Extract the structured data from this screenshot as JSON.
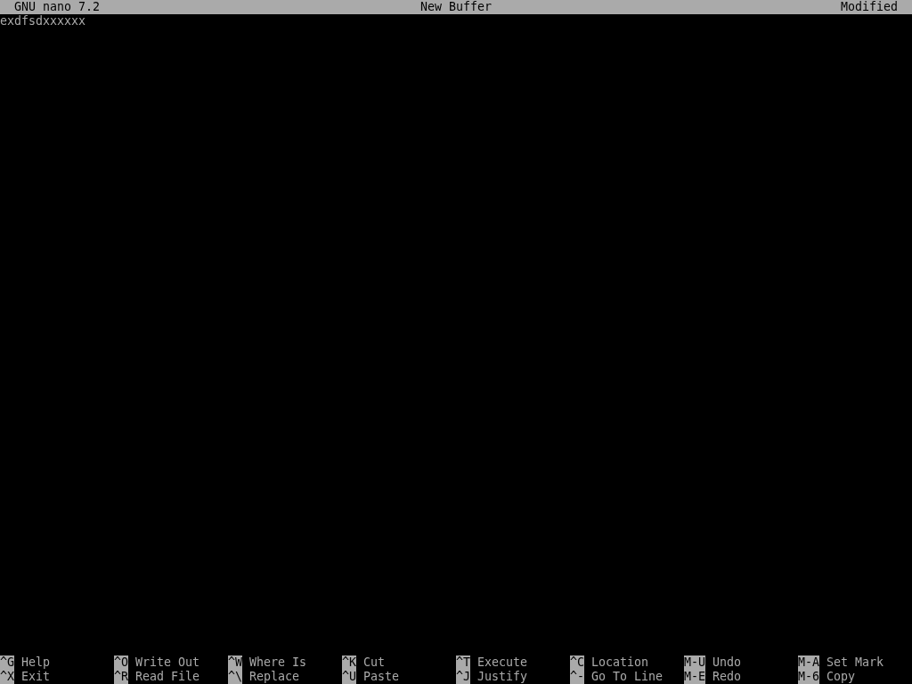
{
  "title_bar": {
    "app": "GNU nano 7.2",
    "file": "New Buffer",
    "state": "Modified"
  },
  "buffer": {
    "lines": [
      "exdfsdxxxxxx"
    ]
  },
  "shortcut_rows": [
    [
      {
        "key": "^G",
        "label": "Help"
      },
      {
        "key": "^O",
        "label": "Write Out"
      },
      {
        "key": "^W",
        "label": "Where Is"
      },
      {
        "key": "^K",
        "label": "Cut"
      },
      {
        "key": "^T",
        "label": "Execute"
      },
      {
        "key": "^C",
        "label": "Location"
      },
      {
        "key": "M-U",
        "label": "Undo"
      },
      {
        "key": "M-A",
        "label": "Set Mark"
      }
    ],
    [
      {
        "key": "^X",
        "label": "Exit"
      },
      {
        "key": "^R",
        "label": "Read File"
      },
      {
        "key": "^\\",
        "label": "Replace"
      },
      {
        "key": "^U",
        "label": "Paste"
      },
      {
        "key": "^J",
        "label": "Justify"
      },
      {
        "key": "^-",
        "label": "Go To Line"
      },
      {
        "key": "M-E",
        "label": "Redo"
      },
      {
        "key": "M-6",
        "label": "Copy"
      }
    ]
  ]
}
